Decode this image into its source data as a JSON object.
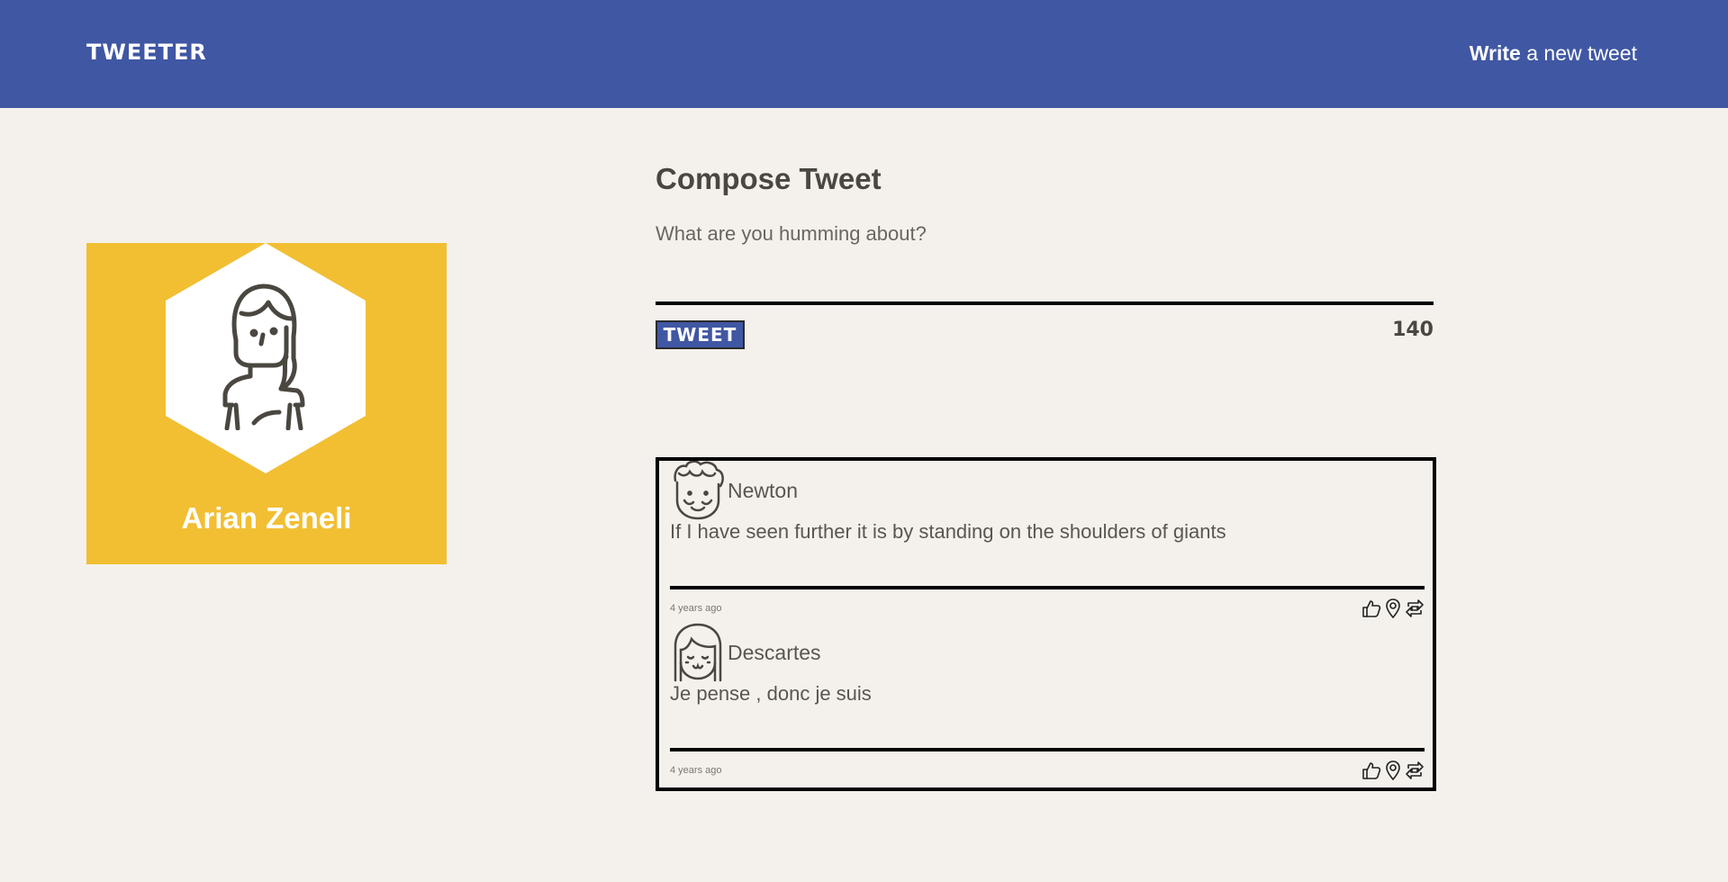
{
  "header": {
    "logo": "TWEETER",
    "write_bold": "Write",
    "write_rest": " a new tweet"
  },
  "profile": {
    "name": "Arian Zeneli",
    "avatar_icon": "girl-avatar-icon",
    "card_color": "#f2bf33"
  },
  "compose": {
    "title": "Compose Tweet",
    "placeholder": "What are you humming about?",
    "button_label": "TWEET",
    "counter": "140"
  },
  "tweets": [
    {
      "author": "Newton",
      "avatar_icon": "curly-hair-avatar-icon",
      "text": "If I have seen further it is by standing on the shoulders of giants",
      "time": "4 years ago"
    },
    {
      "author": "Descartes",
      "avatar_icon": "bob-hair-avatar-icon",
      "text": "Je pense , donc je suis",
      "time": "4 years ago"
    }
  ],
  "colors": {
    "header": "#4057a3",
    "background": "#f4f1ec",
    "text": "#4a4740"
  }
}
